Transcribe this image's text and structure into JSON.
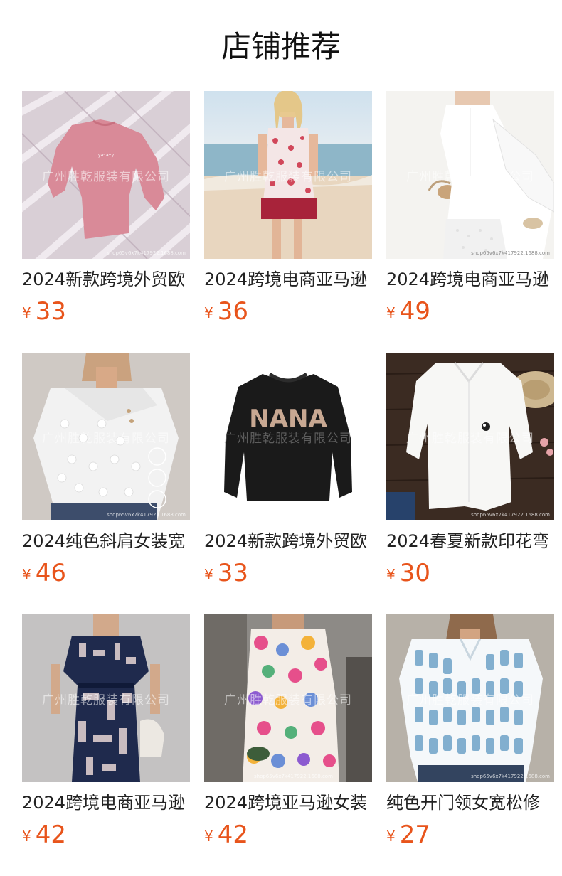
{
  "header": {
    "title": "店铺推荐"
  },
  "currency": "¥",
  "watermark": "广州胜乾服装有限公司",
  "shop_mark": "shop65v6x7k417922.1688.com",
  "products": [
    {
      "name": "2024新款跨境外贸欧",
      "price": "33",
      "image": "pink-sweatshirt-flatlay"
    },
    {
      "name": "2024跨境电商亚马逊",
      "price": "36",
      "image": "floral-beach-dress"
    },
    {
      "name": "2024跨境电商亚马逊",
      "price": "49",
      "image": "white-layered-dress"
    },
    {
      "name": "2024纯色斜肩女装宽",
      "price": "46",
      "image": "white-lace-asymmetric-top"
    },
    {
      "name": "2024新款跨境外贸欧",
      "price": "33",
      "image": "black-nana-sweatshirt",
      "print_text": "NANA"
    },
    {
      "name": "2024春夏新款印花弯",
      "price": "30",
      "image": "white-linen-shirt"
    },
    {
      "name": "2024跨境电商亚马逊",
      "price": "42",
      "image": "navy-geometric-dress"
    },
    {
      "name": "2024跨境亚马逊女装",
      "price": "42",
      "image": "colorful-floral-dress"
    },
    {
      "name": "纯色开门领女宽松修",
      "price": "27",
      "image": "blue-brushstroke-top"
    }
  ]
}
